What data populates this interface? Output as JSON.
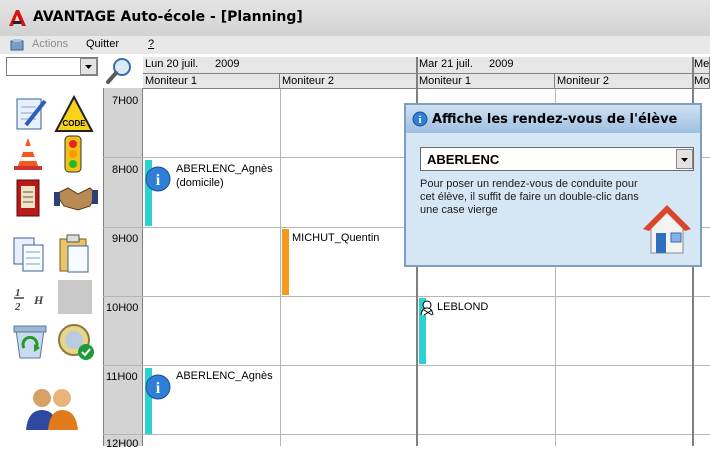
{
  "window": {
    "title": "AVANTAGE Auto-école - [Planning]"
  },
  "menu": {
    "actions": "Actions",
    "quit": "Quitter",
    "help": "?"
  },
  "days": [
    {
      "date": "Lun 20 juil.",
      "year": "2009",
      "columns": [
        "Moniteur 1",
        "Moniteur 2"
      ]
    },
    {
      "date": "Mar 21 juil.",
      "year": "2009",
      "columns": [
        "Moniteur 1",
        "Moniteur 2"
      ]
    },
    {
      "date": "Me",
      "columns": [
        "Mo"
      ]
    }
  ],
  "times": [
    "7H00",
    "8H00",
    "9H00",
    "10H00",
    "11H00",
    "12H00"
  ],
  "appointments": [
    {
      "name": "ABERLENC_Agnès",
      "note": "(domicile)",
      "color": "#2ed1d1",
      "icon": "info-icon"
    },
    {
      "name": "MICHUT_Quentin",
      "color": "#f39a1c"
    },
    {
      "name": "LEBLOND",
      "color": "#2ed1d1",
      "icon": "student-icon"
    },
    {
      "name": "ABERLENC_Agnès",
      "color": "#2ed1d1",
      "icon": "info-icon"
    }
  ],
  "dialog": {
    "title": "Affiche les rendez-vous de l'élève",
    "student": "ABERLENC",
    "hint": "Pour poser un rendez-vous de conduite pour cet élève, il suffit de faire un double-clic dans une case vierge"
  },
  "toolbar_icons": [
    "edit-icon",
    "code-icon",
    "cone-icon",
    "traffic-light-icon",
    "calendar-book-icon",
    "handshake-icon",
    "copy-icon",
    "paste-icon",
    "half-hour-icon",
    "blank-icon",
    "recycle-icon",
    "euro-check-icon",
    "users-icon"
  ],
  "toolbar_labels": {
    "code": "CODE",
    "half_hour": "H"
  },
  "colors": {
    "accent": "#2f7fd6",
    "lesson": "#2ed1d1",
    "alt_lesson": "#f39a1c"
  }
}
